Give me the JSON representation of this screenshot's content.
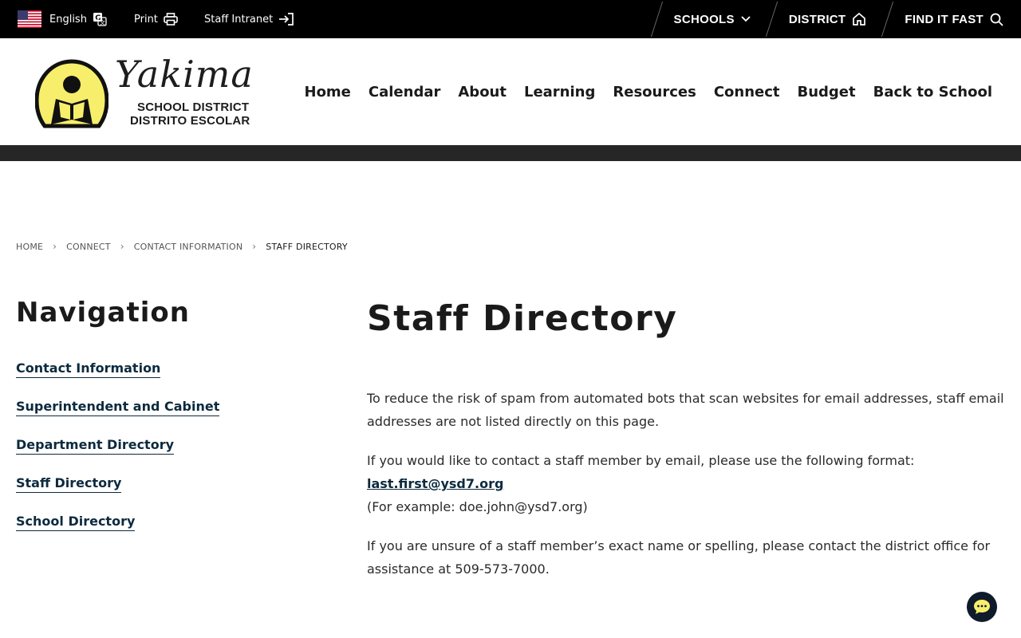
{
  "topbar": {
    "language_label": "English",
    "print_label": "Print",
    "intranet_label": "Staff Intranet",
    "right": [
      {
        "label": "SCHOOLS",
        "icon": "chevron-down-icon"
      },
      {
        "label": "DISTRICT",
        "icon": "home-icon"
      },
      {
        "label": "FIND IT FAST",
        "icon": "search-icon"
      }
    ]
  },
  "logo": {
    "wordmark": "Yakima",
    "line1": "SCHOOL DISTRICT",
    "line2": "DISTRITO ESCOLAR"
  },
  "mainnav": [
    "Home",
    "Calendar",
    "About",
    "Learning",
    "Resources",
    "Connect",
    "Budget",
    "Back to School"
  ],
  "breadcrumb": [
    "HOME",
    "CONNECT",
    "CONTACT INFORMATION",
    "STAFF DIRECTORY"
  ],
  "sidebar": {
    "title": "Navigation",
    "links": [
      "Contact Information",
      "Superintendent and Cabinet",
      "Department Directory",
      "Staff Directory",
      "School Directory"
    ]
  },
  "main": {
    "title": "Staff Directory",
    "p1": "To reduce the risk of spam from automated bots that scan websites for email addresses, staff email addresses are not listed directly on this page.",
    "p2_intro": "If you would like to contact a staff member by email, please use the following format:",
    "p2_link": "last.first@ysd7.org",
    "p2_example": "(For example: doe.john@ysd7.org)",
    "p3": "If you are unsure of a staff member’s exact name or spelling, please contact the district office for assistance at 509-573-7000."
  },
  "colors": {
    "topbar_bg": "#000000",
    "band": "#262626",
    "link": "#0d2a3e",
    "logo_yellow": "#f7ee6b",
    "chat_bg": "#0f1a2b"
  }
}
